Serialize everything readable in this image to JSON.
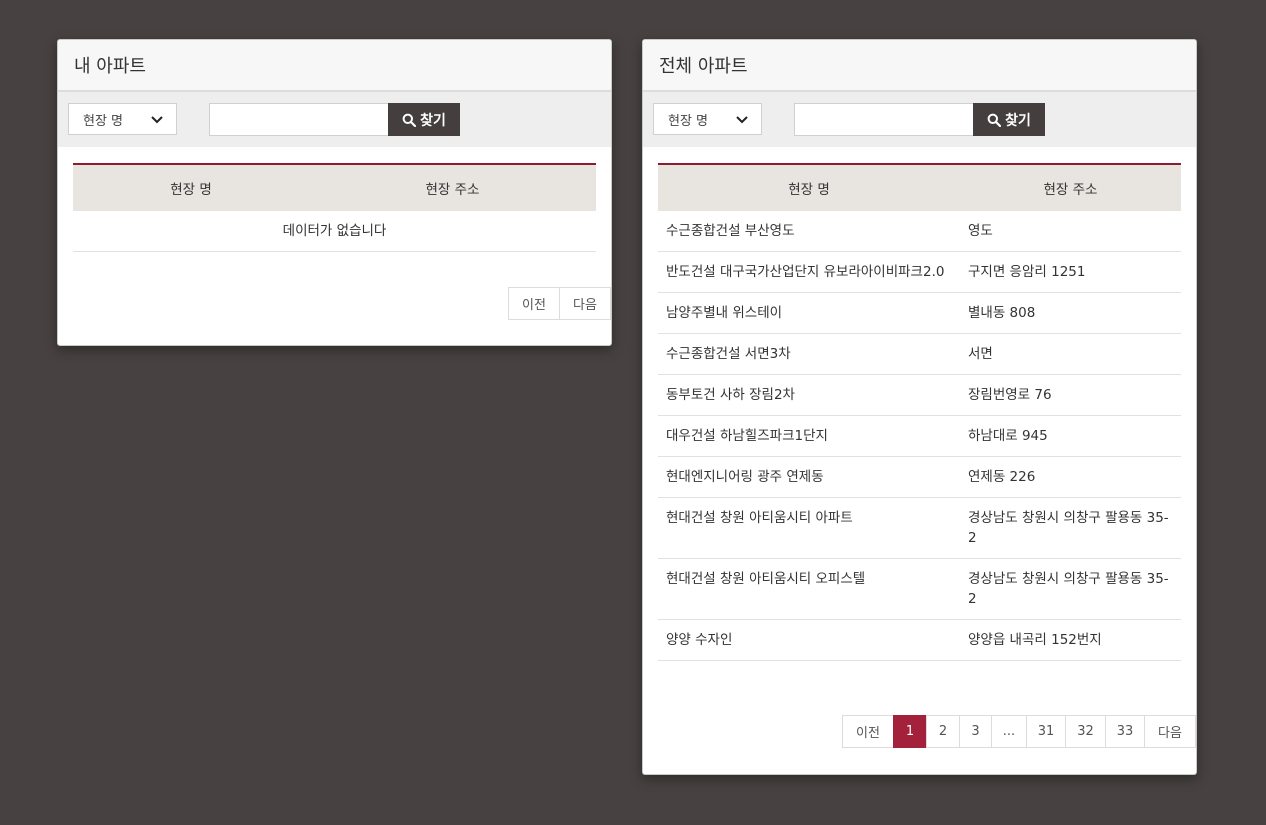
{
  "my_apartment": {
    "title": "내 아파트",
    "select_value": "현장 명",
    "search_value": "",
    "search_button": "찾기",
    "columns": [
      "현장 명",
      "현장 주소"
    ],
    "empty_message": "데이터가 없습니다",
    "pager": {
      "prev": "이전",
      "next": "다음"
    }
  },
  "all_apartments": {
    "title": "전체 아파트",
    "select_value": "현장 명",
    "search_value": "",
    "search_button": "찾기",
    "columns": [
      "현장 명",
      "현장 주소"
    ],
    "rows": [
      [
        "수근종합건설 부산영도",
        "영도"
      ],
      [
        "반도건설 대구국가산업단지 유보라아이비파크2.0",
        "구지면 응암리 1251"
      ],
      [
        "남양주별내 위스테이",
        "별내동 808"
      ],
      [
        "수근종합건설 서면3차",
        "서면"
      ],
      [
        "동부토건 사하 장림2차",
        "장림번영로 76"
      ],
      [
        "대우건설 하남힐즈파크1단지",
        "하남대로 945"
      ],
      [
        "현대엔지니어링 광주 연제동",
        "연제동 226"
      ],
      [
        "현대건설 창원 아티움시티 아파트",
        "경상남도 창원시 의창구 팔용동 35-2"
      ],
      [
        "현대건설 창원 아티움시티 오피스텔",
        "경상남도 창원시 의창구 팔용동 35-2"
      ],
      [
        "양양 수자인",
        "양양읍 내곡리 152번지"
      ]
    ],
    "pager": {
      "prev": "이전",
      "pages": [
        "1",
        "2",
        "3",
        "...",
        "31",
        "32",
        "33"
      ],
      "active": "1",
      "next": "다음"
    }
  },
  "colors": {
    "background": "#474141",
    "table_header_border": "#8b1d31",
    "active_page": "#a3213a",
    "search_button": "#453e3e"
  },
  "icons": {
    "search": "magnifier-icon",
    "dropdown": "chevron-down-icon"
  }
}
